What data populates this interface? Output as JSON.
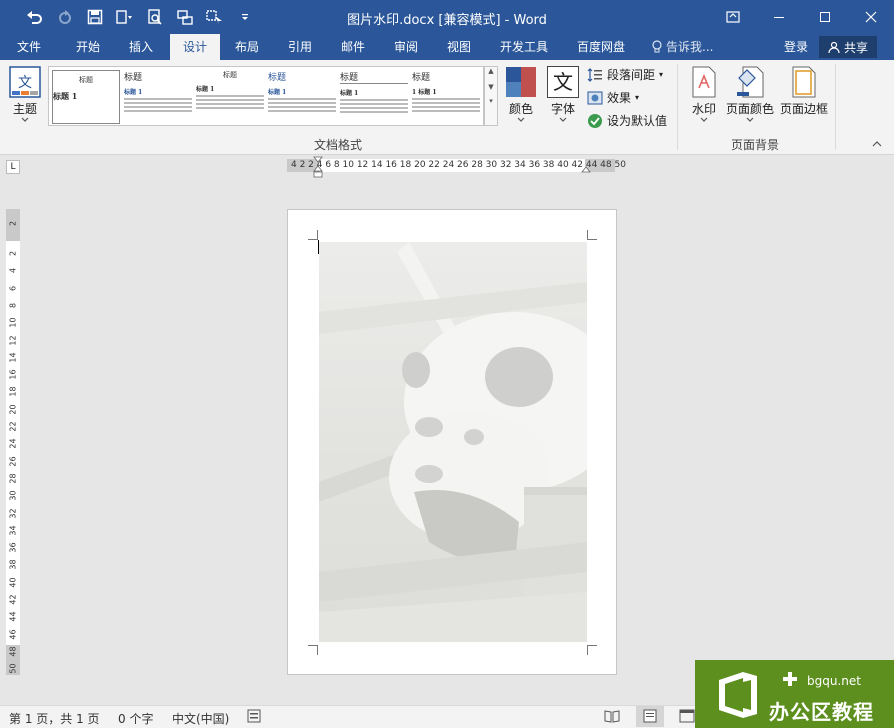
{
  "window": {
    "title": "图片水印.docx [兼容模式] - Word",
    "colors": {
      "brand": "#2b579a",
      "ribbon": "#f3f3f3",
      "canvas": "#e6e6e6"
    }
  },
  "qat": {
    "icons": [
      "undo-icon",
      "redo-icon",
      "save-icon",
      "touch-mode-icon",
      "print-preview-icon",
      "format-painter-icon",
      "select-icon",
      "customize-qat-icon"
    ]
  },
  "tabs": [
    {
      "label": "文件",
      "active": false
    },
    {
      "label": "开始",
      "active": false
    },
    {
      "label": "插入",
      "active": false
    },
    {
      "label": "设计",
      "active": true
    },
    {
      "label": "布局",
      "active": false
    },
    {
      "label": "引用",
      "active": false
    },
    {
      "label": "邮件",
      "active": false
    },
    {
      "label": "审阅",
      "active": false
    },
    {
      "label": "视图",
      "active": false
    },
    {
      "label": "开发工具",
      "active": false
    },
    {
      "label": "百度网盘",
      "active": false
    }
  ],
  "tellme": {
    "label": "告诉我..."
  },
  "account": {
    "login": "登录",
    "share": "共享"
  },
  "ribbon": {
    "theme_label": "主题",
    "group_doc_format": "文档格式",
    "group_page_bg": "页面背景",
    "colors_label": "颜色",
    "fonts_label": "字体",
    "paragraph_spacing": "段落间距",
    "effects": "效果",
    "set_default": "设为默认值",
    "watermark": "水印",
    "page_color": "页面颜色",
    "page_borders": "页面边框",
    "fonts_glyph": "文",
    "gallery": [
      {
        "title": "标题",
        "heading": "标题 1"
      },
      {
        "title": "标题",
        "heading": "标题 1"
      },
      {
        "title": "标题",
        "heading": "标题 1"
      },
      {
        "title": "标题",
        "heading": "标题 1"
      },
      {
        "title": "标题",
        "heading": "标题 1"
      },
      {
        "title": "标题",
        "heading": "1 标题 1"
      }
    ]
  },
  "ruler": {
    "horizontal": "4 2 2 4 6 8 10 12 14 16 18 20 22 24 26 28 30 32 34 36 38 40 42 44 48 50",
    "vertical": [
      "2",
      "2",
      "4",
      "6",
      "8",
      "10",
      "12",
      "14",
      "16",
      "18",
      "20",
      "22",
      "24",
      "26",
      "28",
      "30",
      "32",
      "34",
      "36",
      "38",
      "40",
      "42",
      "44",
      "46",
      "48",
      "50"
    ]
  },
  "status": {
    "page": "第 1 页，共 1 页",
    "words": "0 个字",
    "language": "中文(中国)"
  },
  "logo": {
    "url": "bgqu.net",
    "name": "办公区教程"
  }
}
